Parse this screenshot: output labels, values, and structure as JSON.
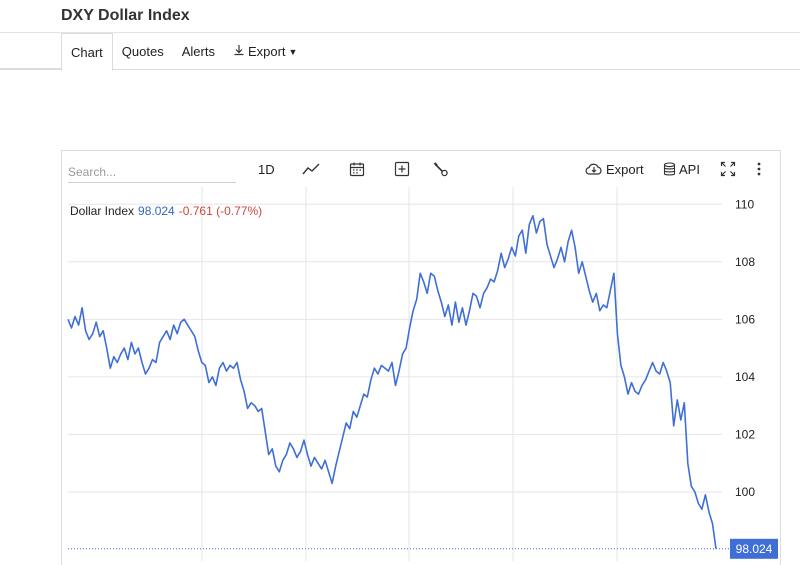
{
  "page": {
    "title": "DXY Dollar Index"
  },
  "nav": {
    "tabs": [
      {
        "label": "Chart"
      },
      {
        "label": "Quotes"
      },
      {
        "label": "Alerts"
      },
      {
        "label": "Export"
      }
    ]
  },
  "toolbar": {
    "search_placeholder": "Search...",
    "period_label": "1D",
    "export_label": "Export",
    "api_label": "API",
    "icons": [
      "line-chart-icon",
      "calendar-icon",
      "plus-box-icon",
      "wrench-icon",
      "cloud-download-icon",
      "database-icon",
      "fullscreen-icon",
      "more-vertical-icon"
    ]
  },
  "legend": {
    "name": "Dollar Index",
    "value": "98.024",
    "change": "-0.761 (-0.77%)"
  },
  "colors": {
    "line": "#3f6fd6",
    "last_price_bg": "#3f6fd6",
    "change_negative": "#d0473d",
    "grid": "#e6e6e6"
  },
  "chart_data": {
    "type": "line",
    "series": [
      {
        "values": [
          106.0,
          105.7,
          106.1,
          105.8,
          106.4,
          105.6,
          105.3,
          105.5,
          105.9,
          105.4,
          105.6,
          105.0,
          104.3,
          104.7,
          104.5,
          104.8,
          105.0,
          104.6,
          105.2,
          104.8,
          105.0,
          104.5,
          104.1,
          104.3,
          104.6,
          104.5,
          105.2,
          105.4,
          105.6,
          105.3,
          105.8,
          105.5,
          105.9,
          106.0,
          105.8,
          105.6,
          105.4,
          104.9,
          104.5,
          104.4,
          103.8,
          104.0,
          103.7,
          104.3,
          104.5,
          104.2,
          104.4,
          104.3,
          104.5,
          103.9,
          103.5,
          102.9,
          103.1,
          103.0,
          102.8,
          102.9,
          102.1,
          101.3,
          101.5,
          100.9,
          100.7,
          101.1,
          101.3,
          101.7,
          101.5,
          101.2,
          101.4,
          101.8,
          101.3,
          100.9,
          101.2,
          101.0,
          100.8,
          101.1,
          100.7,
          100.3,
          100.9,
          101.4,
          101.9,
          102.4,
          102.2,
          102.8,
          102.6,
          103.0,
          103.4,
          103.3,
          103.9,
          104.3,
          104.1,
          104.4,
          104.3,
          104.2,
          104.5,
          103.7,
          104.2,
          104.8,
          105.0,
          105.7,
          106.3,
          106.7,
          107.6,
          107.3,
          106.9,
          107.6,
          107.5,
          107.0,
          106.6,
          106.1,
          106.5,
          105.8,
          106.6,
          105.9,
          106.4,
          105.8,
          106.3,
          106.9,
          106.8,
          106.4,
          106.9,
          107.1,
          107.4,
          107.3,
          107.7,
          108.3,
          107.8,
          108.1,
          108.5,
          108.2,
          108.9,
          109.1,
          108.3,
          109.3,
          109.6,
          109.0,
          109.4,
          109.5,
          108.6,
          108.2,
          107.8,
          108.1,
          108.5,
          108.0,
          108.7,
          109.1,
          108.5,
          107.6,
          108.0,
          107.5,
          107.0,
          106.6,
          106.9,
          106.3,
          106.5,
          106.4,
          107.0,
          107.6,
          105.5,
          104.4,
          104.0,
          103.4,
          103.8,
          103.5,
          103.4,
          103.7,
          103.9,
          104.2,
          104.5,
          104.2,
          104.1,
          104.5,
          104.2,
          103.8,
          102.3,
          103.2,
          102.5,
          103.1,
          101.0,
          100.2,
          100.0,
          99.6,
          99.4,
          99.9,
          99.3,
          98.9,
          98.024
        ]
      }
    ],
    "yticks": [
      "110",
      "108",
      "106",
      "104",
      "102",
      "100"
    ],
    "ylim": [
      97.6,
      110.6
    ],
    "last_price": "98.024",
    "grid": true
  }
}
